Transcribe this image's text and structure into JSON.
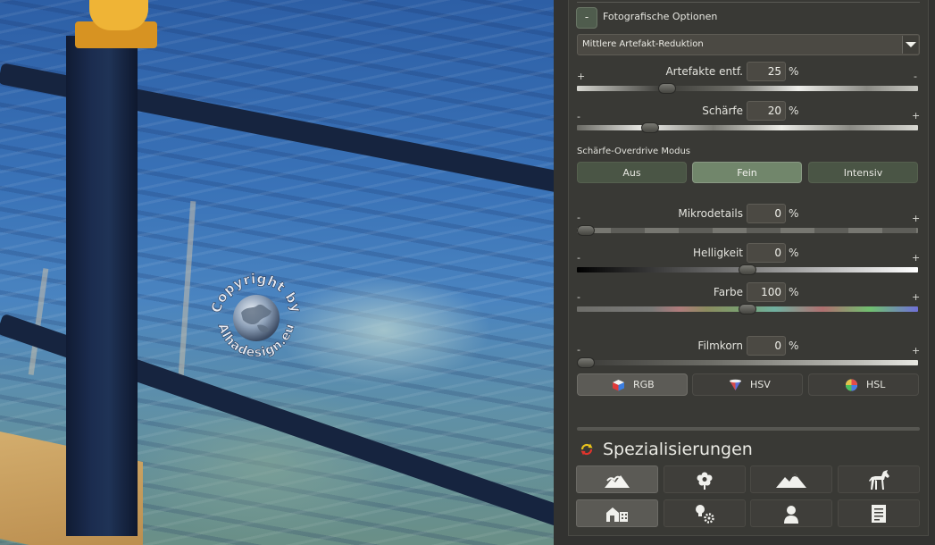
{
  "image": {
    "watermark_lines": [
      "Copyright by",
      "Alhadesign.eu"
    ]
  },
  "photo_options": {
    "collapse_label": "-",
    "title": "Fotografische Optionen",
    "preset": "Mittlere Artefakt-Reduktion"
  },
  "sliders": {
    "artefakte": {
      "label": "Artefakte entf.",
      "value": "25",
      "unit": "%",
      "left_sign": "+",
      "right_sign": "-",
      "level": 0.25
    },
    "schaerfe": {
      "label": "Schärfe",
      "value": "20",
      "unit": "%",
      "left_sign": "-",
      "right_sign": "+",
      "level": 0.2
    },
    "mikrodetails": {
      "label": "Mikrodetails",
      "value": "0",
      "unit": "%",
      "left_sign": "-",
      "right_sign": "+",
      "level": 0.0
    },
    "helligkeit": {
      "label": "Helligkeit",
      "value": "0",
      "unit": "%",
      "left_sign": "-",
      "right_sign": "+",
      "level": 0.5
    },
    "farbe": {
      "label": "Farbe",
      "value": "100",
      "unit": "%",
      "left_sign": "-",
      "right_sign": "+",
      "level": 0.5
    },
    "filmkorn": {
      "label": "Filmkorn",
      "value": "0",
      "unit": "%",
      "left_sign": "-",
      "right_sign": "+",
      "level": 0.0
    }
  },
  "overdrive": {
    "title": "Schärfe-Overdrive Modus",
    "options": [
      "Aus",
      "Fein",
      "Intensiv"
    ],
    "selected": "Fein"
  },
  "color_modes": {
    "options": [
      "RGB",
      "HSV",
      "HSL"
    ],
    "selected": "RGB"
  },
  "specializations": {
    "title": "Spezialisierungen",
    "icon": "refresh-arrows-icon",
    "tiles": [
      "landscape-icon",
      "flower-icon",
      "mountain-icon",
      "horse-icon",
      "buildings-icon",
      "lightbulb-gear-icon",
      "person-icon",
      "document-icon"
    ],
    "selected": [
      "landscape-icon",
      "buildings-icon"
    ]
  },
  "colors": {
    "accent_green": "#71866b",
    "button_green": "#4a5545",
    "panel_bg": "#393935"
  }
}
